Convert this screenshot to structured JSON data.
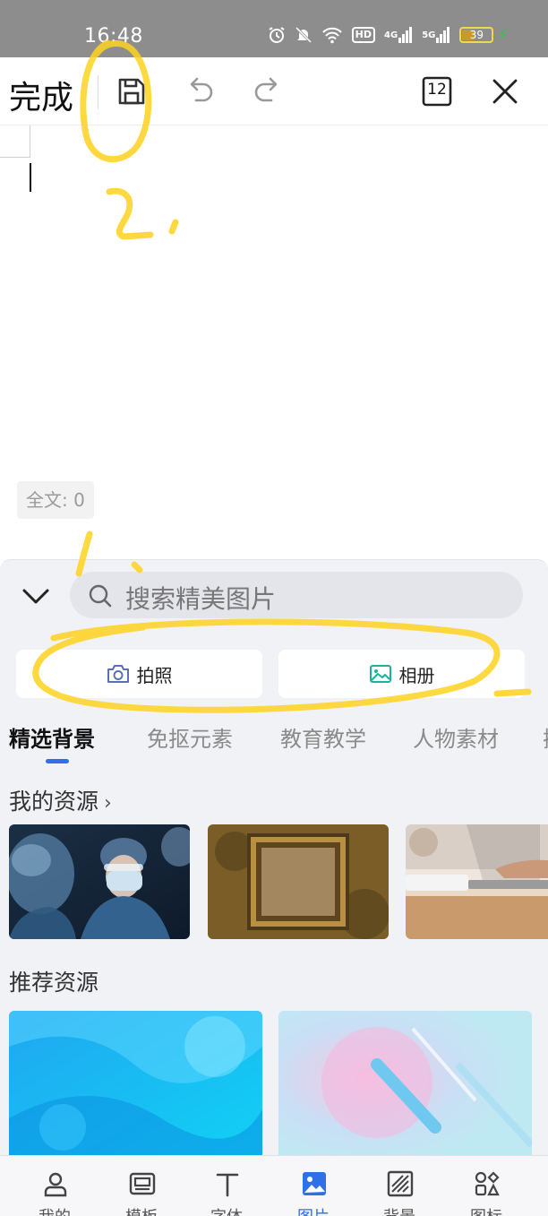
{
  "status_bar": {
    "time": "16:48",
    "hd_label": "HD",
    "signal1_label": "4G",
    "signal2_label": "5G",
    "battery_level": "39",
    "battery_fraction": 0.39,
    "icons": [
      "alarm-icon",
      "mute-icon",
      "wifi-icon",
      "hd-icon",
      "signal-icon",
      "signal-icon",
      "battery-icon",
      "charging-icon"
    ]
  },
  "toolbar": {
    "done_label": "完成",
    "page_badge": "12",
    "icons": [
      "save-icon",
      "undo-icon",
      "redo-icon",
      "page-badge-icon",
      "close-icon"
    ]
  },
  "editor": {
    "word_count": "全文: 0"
  },
  "panel": {
    "search": {
      "placeholder": "搜索精美图片"
    },
    "camera_label": "拍照",
    "album_label": "相册",
    "category_tabs": [
      "精选背景",
      "免抠元素",
      "教育教学",
      "人物素材",
      "插"
    ],
    "active_tab": 0,
    "my_resources_title": "我的资源",
    "recommended_title": "推荐资源"
  },
  "bottom_nav": {
    "items": [
      {
        "label": "我的",
        "icon": "user-icon"
      },
      {
        "label": "模板",
        "icon": "template-icon"
      },
      {
        "label": "字体",
        "icon": "text-icon"
      },
      {
        "label": "图片",
        "icon": "image-icon"
      },
      {
        "label": "背景",
        "icon": "background-icon"
      },
      {
        "label": "图标",
        "icon": "shapes-icon"
      }
    ],
    "active_index": 3
  },
  "colors": {
    "accent": "#2f6fe8",
    "highlight_scribble": "#ffd21f",
    "camera_icon": "#5b6fb8",
    "album_icon": "#1cb39a"
  }
}
